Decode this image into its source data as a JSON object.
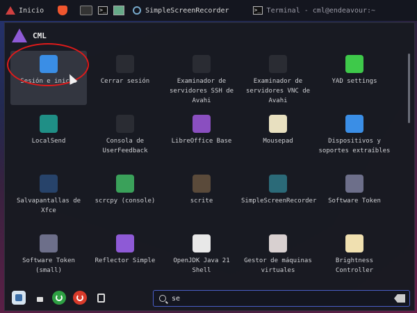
{
  "taskbar": {
    "start_label": "Inicio",
    "tasks": [
      {
        "label": "SimpleScreenRecorder"
      },
      {
        "label": "Terminal - cml@endeavour:~"
      }
    ]
  },
  "menu": {
    "title": "CML",
    "apps": [
      {
        "label": "Sesión e inicio",
        "icon": "session-startup-icon",
        "color": "#3a8ee6",
        "selected": true
      },
      {
        "label": "Cerrar sesión",
        "icon": "logout-icon",
        "color": "#2a2c33"
      },
      {
        "label": "Examinador de servidores SSH de Avahi",
        "icon": "avahi-ssh-icon",
        "color": "#2a2c33"
      },
      {
        "label": "Examinador de servidores VNC de Avahi",
        "icon": "avahi-vnc-icon",
        "color": "#2a2c33"
      },
      {
        "label": "YAD settings",
        "icon": "yad-settings-icon",
        "color": "#3ec94a"
      },
      {
        "label": "LocalSend",
        "icon": "localsend-icon",
        "color": "#1f8f86"
      },
      {
        "label": "Consola de UserFeedback",
        "icon": "userfeedback-icon",
        "color": "#2a2c33"
      },
      {
        "label": "LibreOffice Base",
        "icon": "libreoffice-base-icon",
        "color": "#8a4fc0"
      },
      {
        "label": "Mousepad",
        "icon": "mousepad-icon",
        "color": "#e8e0c0"
      },
      {
        "label": "Dispositivos y soportes extraíbles",
        "icon": "usb-devices-icon",
        "color": "#3a8ee6"
      },
      {
        "label": "Salvapantallas de Xfce",
        "icon": "screensaver-icon",
        "color": "#27436a"
      },
      {
        "label": "scrcpy (console)",
        "icon": "scrcpy-icon",
        "color": "#3aa15a"
      },
      {
        "label": "scrite",
        "icon": "scrite-icon",
        "color": "#5a4a3a"
      },
      {
        "label": "SimpleScreenRecorder",
        "icon": "simplescreenrecorder-icon",
        "color": "#2b6a78"
      },
      {
        "label": "Software Token",
        "icon": "software-token-icon",
        "color": "#6d6f8a"
      },
      {
        "label": "Software Token (small)",
        "icon": "software-token-small-icon",
        "color": "#6d6f8a"
      },
      {
        "label": "Reflector Simple",
        "icon": "reflector-simple-icon",
        "color": "#8e5ad6"
      },
      {
        "label": "OpenJDK Java 21 Shell",
        "icon": "openjdk-icon",
        "color": "#e8e8e8"
      },
      {
        "label": "Gestor de máquinas virtuales",
        "icon": "virt-manager-icon",
        "color": "#d8d0d0"
      },
      {
        "label": "Brightness Controller",
        "icon": "brightness-icon",
        "color": "#f0e0b0"
      }
    ]
  },
  "search": {
    "value": "se"
  },
  "colors": {
    "accent": "#4a5fc8",
    "annotation": "#e01a1a"
  }
}
